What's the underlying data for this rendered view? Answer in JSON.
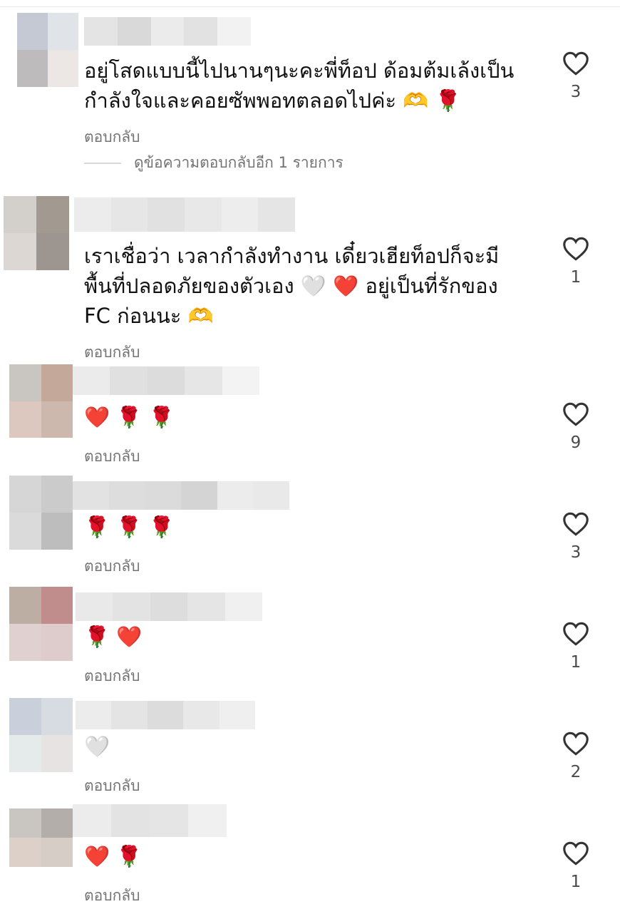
{
  "comments": [
    {
      "text_lines": [
        "อยู่โสดแบบนี้ไปนานๆนะคะพี่ท็อป ด้อมต้มเล้งเป็น",
        "กำลังใจและคอยซัพพอทตลอดไปค่ะ"
      ],
      "emojis": [
        "🫶",
        "🌹"
      ],
      "like_count": "3",
      "reply_label": "ตอบกลับ",
      "view_replies": "ดูข้อความตอบกลับอีก 1 รายการ"
    },
    {
      "text_lines": [
        "เราเชื่อว่า เวลากำลังทำงาน เดี๋ยวเฮียท็อปก็จะมี",
        "พื้นที่ปลอดภัยของตัวเอง",
        "อยู่เป็นที่รักของ",
        "FC ก่อนนะ"
      ],
      "emojis": [
        "🤍",
        "❤️",
        "🫶"
      ],
      "like_count": "1",
      "reply_label": "ตอบกลับ"
    },
    {
      "emojis": [
        "❤️",
        "🌹",
        "🌹"
      ],
      "like_count": "9",
      "reply_label": "ตอบกลับ"
    },
    {
      "emojis": [
        "🌹",
        "🌹",
        "🌹"
      ],
      "like_count": "3",
      "reply_label": "ตอบกลับ"
    },
    {
      "emojis": [
        "🌹",
        "❤️"
      ],
      "like_count": "1",
      "reply_label": "ตอบกลับ"
    },
    {
      "emojis": [
        "🤍"
      ],
      "like_count": "2",
      "reply_label": "ตอบกลับ"
    },
    {
      "emojis": [
        "❤️",
        "🌹"
      ],
      "like_count": "1",
      "reply_label": "ตอบกลับ"
    }
  ],
  "colors": {
    "text": "#111111",
    "secondary": "#737373",
    "heart_outline": "#333333",
    "count": "#4a4a4a"
  },
  "icons": {
    "like": "heart-outline-icon"
  }
}
